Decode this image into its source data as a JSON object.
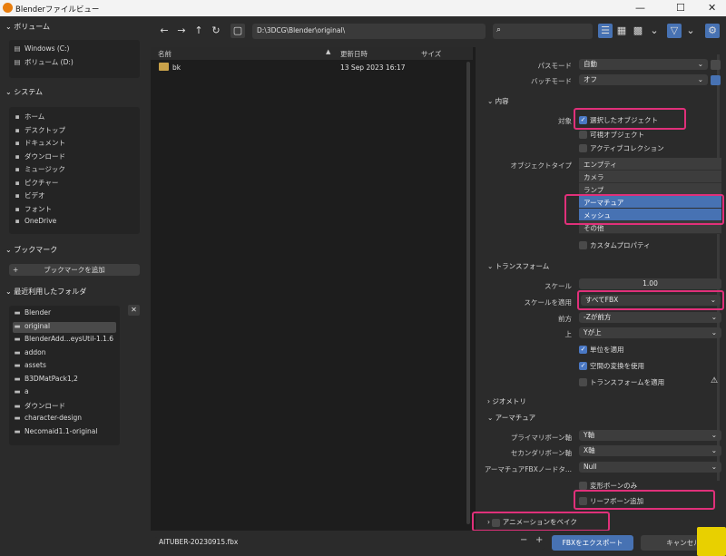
{
  "window": {
    "title": "Blenderファイルビュー"
  },
  "left": {
    "volumes_title": "ボリューム",
    "volumes": [
      "Windows (C:)",
      "ボリューム (D:)"
    ],
    "system_title": "システム",
    "system": [
      {
        "icon": "home-icon",
        "label": "ホーム"
      },
      {
        "icon": "desktop-icon",
        "label": "デスクトップ"
      },
      {
        "icon": "document-icon",
        "label": "ドキュメント"
      },
      {
        "icon": "download-icon",
        "label": "ダウンロード"
      },
      {
        "icon": "music-icon",
        "label": "ミュージック"
      },
      {
        "icon": "picture-icon",
        "label": "ピクチャー"
      },
      {
        "icon": "video-icon",
        "label": "ビデオ"
      },
      {
        "icon": "font-icon",
        "label": "フォント"
      },
      {
        "icon": "cloud-icon",
        "label": "OneDrive"
      }
    ],
    "bookmarks_title": "ブックマーク",
    "add_bookmark": "ブックマークを追加",
    "recent_title": "最近利用したフォルダ",
    "recent": [
      "Blender",
      "original",
      "BlenderAdd...eysUtil-1.1.6",
      "addon",
      "assets",
      "B3DMatPack1,2",
      "a",
      "ダウンロード",
      "character-design",
      "Necomaid1.1-original"
    ]
  },
  "toolbar": {
    "path": "D:\\3DCG\\Blender\\original\\"
  },
  "files": {
    "col_name": "名前",
    "col_date": "更新日時",
    "col_size": "サイズ",
    "rows": [
      {
        "name": "bk",
        "date": "13 Sep 2023 16:17"
      }
    ]
  },
  "props": {
    "path_mode_label": "パスモード",
    "path_mode": "自動",
    "batch_label": "バッチモード",
    "batch": "オフ",
    "include_title": "内容",
    "target_label": "対象",
    "selected_only": "選択したオブジェクト",
    "visible": "可視オブジェクト",
    "active_coll": "アクティブコレクション",
    "obj_type_label": "オブジェクトタイプ",
    "obj_types": [
      "エンプティ",
      "カメラ",
      "ランプ",
      "アーマチュア",
      "メッシュ",
      "その他"
    ],
    "custom_props": "カスタムプロパティ",
    "transform_title": "トランスフォーム",
    "scale_label": "スケール",
    "scale": "1.00",
    "apply_scale_label": "スケールを適用",
    "apply_scale": "すべてFBX",
    "forward_label": "前方",
    "forward": "-Zが前方",
    "up_label": "上",
    "up": "Yが上",
    "apply_unit": "単位を適用",
    "space_transform": "空間の変換を使用",
    "apply_transform": "トランスフォームを適用",
    "geometry_title": "ジオメトリ",
    "armature_title": "アーマチュア",
    "primary_bone_label": "プライマリボーン軸",
    "primary_bone": "Y軸",
    "secondary_bone_label": "セカンダリボーン軸",
    "secondary_bone": "X軸",
    "node_type_label": "アーマチュアFBXノードタ...",
    "node_type": "Null",
    "deform_only": "変形ボーンのみ",
    "leaf_bones": "リーフボーン追加",
    "bake_anim": "アニメーションをベイク"
  },
  "bottom": {
    "filename": "AITUBER-20230915.fbx",
    "export": "FBXをエクスポート",
    "cancel": "キャンセル"
  }
}
